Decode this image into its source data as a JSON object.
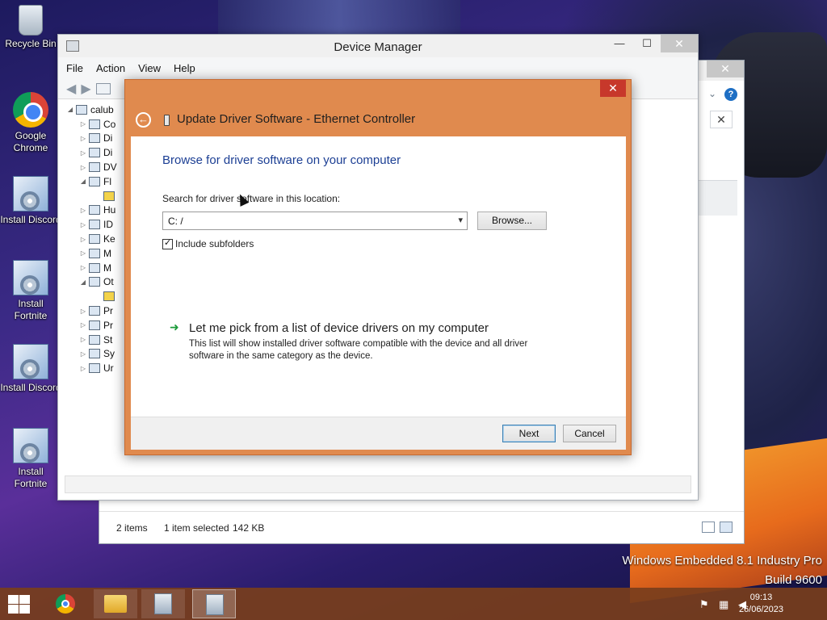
{
  "desktop": {
    "icons": [
      {
        "label": "Recycle Bin"
      },
      {
        "label": "Google Chrome"
      },
      {
        "label": "Install Discord"
      },
      {
        "label": "Install Fortnite"
      },
      {
        "label": "Install Discord"
      },
      {
        "label": "Install Fortnite"
      }
    ]
  },
  "explorer": {
    "close_glyph": "✕",
    "help_glyph": "?",
    "status_items": "2 items",
    "status_selected": "1 item selected",
    "status_size": "142 KB"
  },
  "device_manager": {
    "title": "Device Manager",
    "menu": [
      "File",
      "Action",
      "View",
      "Help"
    ],
    "minimize_glyph": "—",
    "maximize_glyph": "☐",
    "close_glyph": "✕",
    "tree_root": "calub",
    "tree_items": [
      "Co",
      "Di",
      "Di",
      "DV",
      "Fl",
      "",
      "Hu",
      "ID",
      "Ke",
      "M",
      "M",
      "Ot",
      "",
      "Pr",
      "Pr",
      "St",
      "Sy",
      "Ur"
    ]
  },
  "dialog": {
    "title": "Update Driver Software - Ethernet Controller",
    "close_glyph": "✕",
    "back_glyph": "←",
    "heading": "Browse for driver software on your computer",
    "search_label": "Search for driver software in this location:",
    "path_value": "C: /",
    "browse_label": "Browse...",
    "include_subfolders_label": "Include subfolders",
    "include_subfolders_checked": true,
    "pick_title": "Let me pick from a list of device drivers on my computer",
    "pick_description": "This list will show installed driver software compatible with the device and all driver software in the same category as the device.",
    "next_label": "Next",
    "cancel_label": "Cancel"
  },
  "watermark": {
    "line1": "Windows Embedded 8.1 Industry Pro",
    "line2": "Build 9600"
  },
  "taskbar": {
    "time": "09:13",
    "date": "26/06/2023"
  },
  "colors": {
    "dialog_accent": "#e08a4e",
    "heading_blue": "#1c3f94",
    "taskbar": "#783e1c"
  }
}
